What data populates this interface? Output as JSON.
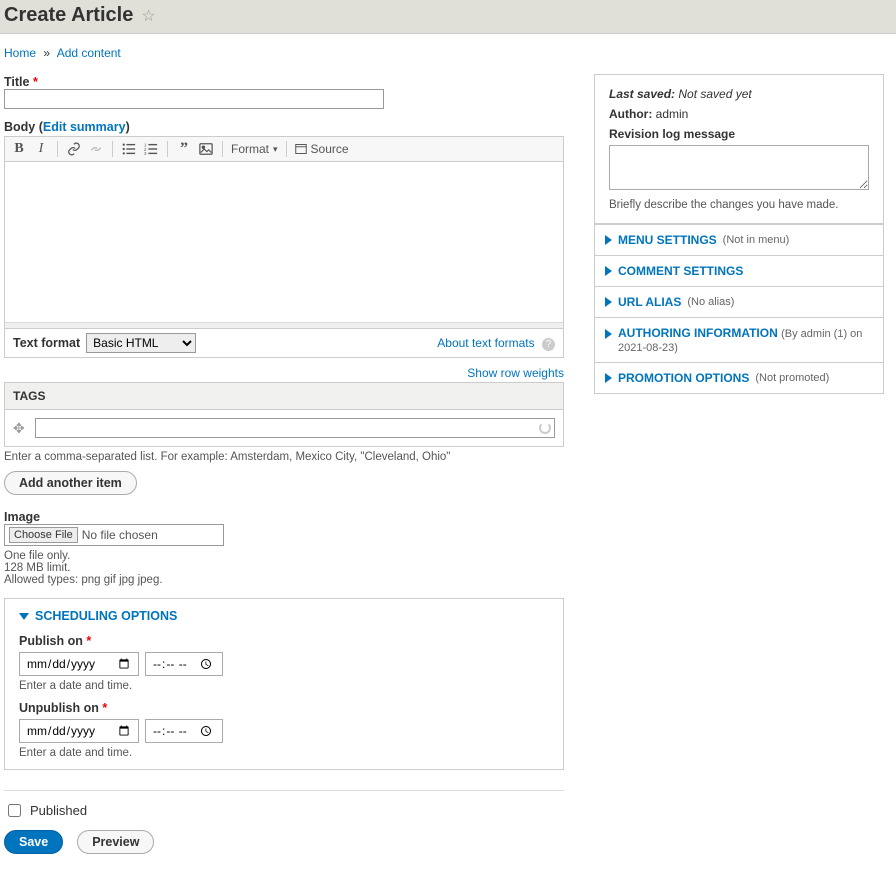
{
  "page": {
    "title": "Create Article"
  },
  "breadcrumb": {
    "home": "Home",
    "sep": "»",
    "add_content": "Add content"
  },
  "form": {
    "title_label": "Title",
    "body_label": "Body",
    "edit_summary": "Edit summary",
    "toolbar": {
      "format_label": "Format",
      "source_label": "Source"
    },
    "text_format_label": "Text format",
    "text_format_value": "Basic HTML",
    "about_formats": "About text formats",
    "show_row_weights": "Show row weights",
    "tags_label": "TAGS",
    "tags_help": "Enter a comma-separated list. For example: Amsterdam, Mexico City, \"Cleveland, Ohio\"",
    "add_another": "Add another item",
    "image_label": "Image",
    "choose_file": "Choose File",
    "no_file": "No file chosen",
    "file_help1": "One file only.",
    "file_help2": "128 MB limit.",
    "file_help3": "Allowed types: png gif jpg jpeg.",
    "scheduling": {
      "heading": "SCHEDULING OPTIONS",
      "publish_label": "Publish on",
      "unpublish_label": "Unpublish on",
      "date_placeholder": "mm/dd/yyyy",
      "time_placeholder": "--:-- --",
      "help": "Enter a date and time."
    },
    "published_label": "Published",
    "save": "Save",
    "preview": "Preview"
  },
  "sidebar": {
    "last_saved_label": "Last saved:",
    "last_saved_value": "Not saved yet",
    "author_label": "Author:",
    "author_value": "admin",
    "revision_label": "Revision log message",
    "revision_help": "Briefly describe the changes you have made.",
    "details": [
      {
        "title": "MENU SETTINGS",
        "summary": "(Not in menu)"
      },
      {
        "title": "COMMENT SETTINGS",
        "summary": ""
      },
      {
        "title": "URL ALIAS",
        "summary": "(No alias)"
      },
      {
        "title": "AUTHORING INFORMATION",
        "summary": "(By admin (1) on 2021-08-23)"
      },
      {
        "title": "PROMOTION OPTIONS",
        "summary": "(Not promoted)"
      }
    ]
  }
}
